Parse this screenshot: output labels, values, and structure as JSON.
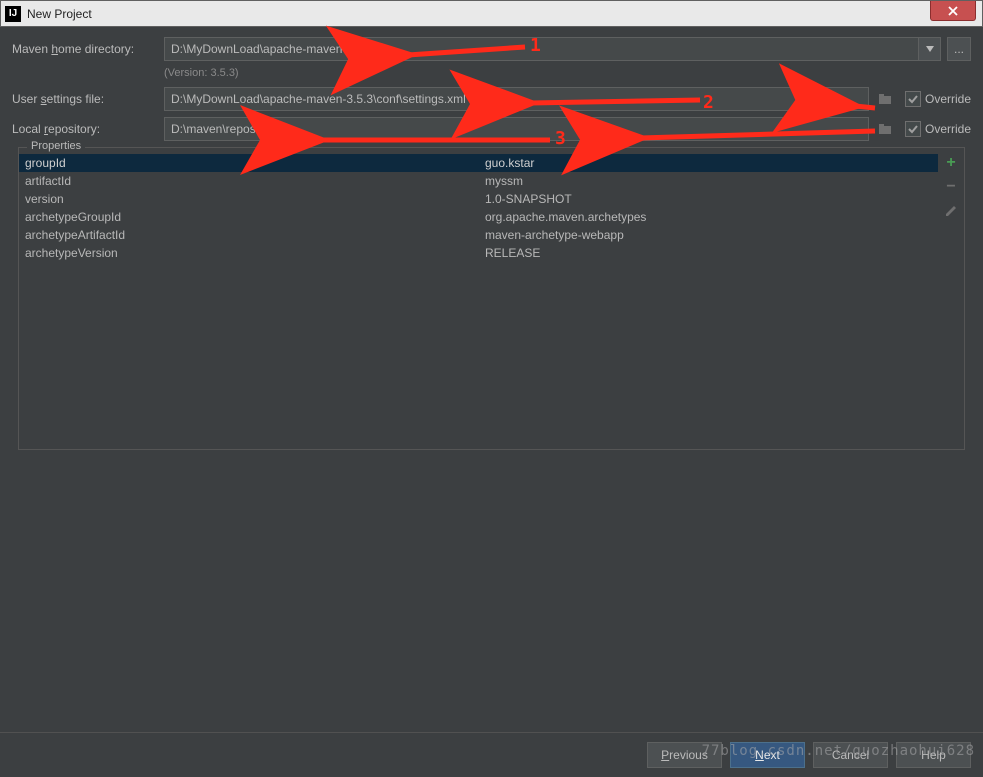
{
  "window": {
    "title": "New Project"
  },
  "fields": {
    "maven_home_label_pre": "Maven ",
    "maven_home_label_u": "h",
    "maven_home_label_post": "ome directory:",
    "maven_home_value": "D:\\MyDownLoad\\apache-maven-3.5.3",
    "maven_version": "(Version: 3.5.3)",
    "user_settings_label_pre": "User ",
    "user_settings_label_u": "s",
    "user_settings_label_post": "ettings file:",
    "user_settings_value": "D:\\MyDownLoad\\apache-maven-3.5.3\\conf\\settings.xml",
    "local_repo_label_pre": "Local ",
    "local_repo_label_u": "r",
    "local_repo_label_post": "epository:",
    "local_repo_value": "D:\\maven\\repository",
    "override_label": "Override",
    "properties_legend": "Properties"
  },
  "override": {
    "settings": true,
    "repo": true
  },
  "properties": [
    {
      "key": "groupId",
      "value": "guo.kstar",
      "selected": true
    },
    {
      "key": "artifactId",
      "value": "myssm"
    },
    {
      "key": "version",
      "value": "1.0-SNAPSHOT"
    },
    {
      "key": "archetypeGroupId",
      "value": "org.apache.maven.archetypes"
    },
    {
      "key": "archetypeArtifactId",
      "value": "maven-archetype-webapp"
    },
    {
      "key": "archetypeVersion",
      "value": "RELEASE"
    }
  ],
  "annotations": {
    "n1": "1",
    "n2": "2",
    "n3": "3"
  },
  "buttons": {
    "previous_u": "P",
    "previous_rest": "revious",
    "next_u": "N",
    "next_rest": "ext",
    "cancel": "Cancel",
    "help": "Help"
  },
  "watermark": "77blog.csdn.net/guozhaohui628"
}
